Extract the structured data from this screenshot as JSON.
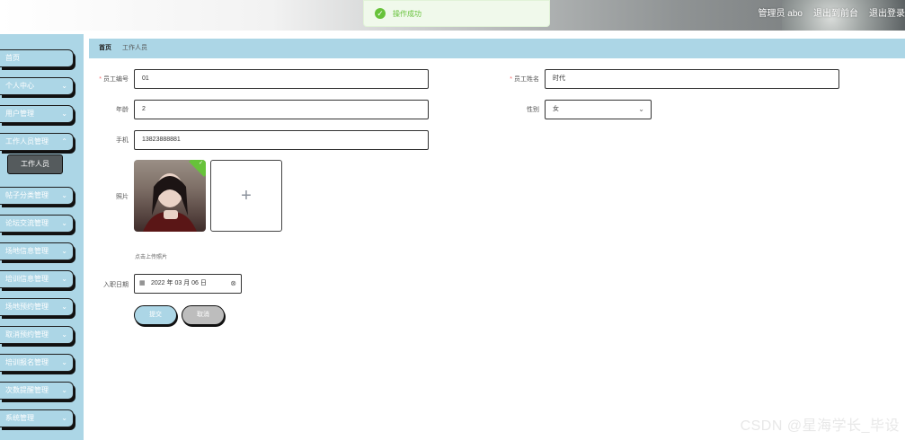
{
  "header": {
    "user_label": "管理员 abo",
    "back_label": "退出到前台",
    "logout_label": "退出登录"
  },
  "toast": {
    "message": "操作成功"
  },
  "sidebar": {
    "items": [
      {
        "label": "首页",
        "has_children": false
      },
      {
        "label": "个人中心",
        "has_children": true
      },
      {
        "label": "用户管理",
        "has_children": true
      },
      {
        "label": "工作人员管理",
        "has_children": true
      },
      {
        "label": "帖子分类管理",
        "has_children": true
      },
      {
        "label": "论坛交流管理",
        "has_children": true
      },
      {
        "label": "场地信息管理",
        "has_children": true
      },
      {
        "label": "培训信息管理",
        "has_children": true
      },
      {
        "label": "场地预约管理",
        "has_children": true
      },
      {
        "label": "取消预约管理",
        "has_children": true
      },
      {
        "label": "培训报名管理",
        "has_children": true
      },
      {
        "label": "次数提醒管理",
        "has_children": true
      },
      {
        "label": "系统管理",
        "has_children": true
      }
    ],
    "active_subitem": "工作人员"
  },
  "breadcrumb": {
    "home": "首页",
    "current": "工作人员"
  },
  "form": {
    "employee_id_label": "员工编号",
    "employee_id_value": "01",
    "employee_name_label": "员工姓名",
    "employee_name_value": "时代",
    "age_label": "年龄",
    "age_value": "2",
    "gender_label": "性别",
    "gender_value": "女",
    "phone_label": "手机",
    "phone_value": "13823888881",
    "photo_label": "照片",
    "photo_hint": "点击上传照片",
    "upload_plus": "+",
    "join_date_label": "入职日期",
    "join_date_value": "2022 年 03 月 06 日",
    "submit_label": "提交",
    "cancel_label": "取消"
  },
  "watermark": "CSDN @星海学长_毕设",
  "colors": {
    "accent": "#acd6e6",
    "success": "#67c23a",
    "required": "#f56c6c"
  }
}
